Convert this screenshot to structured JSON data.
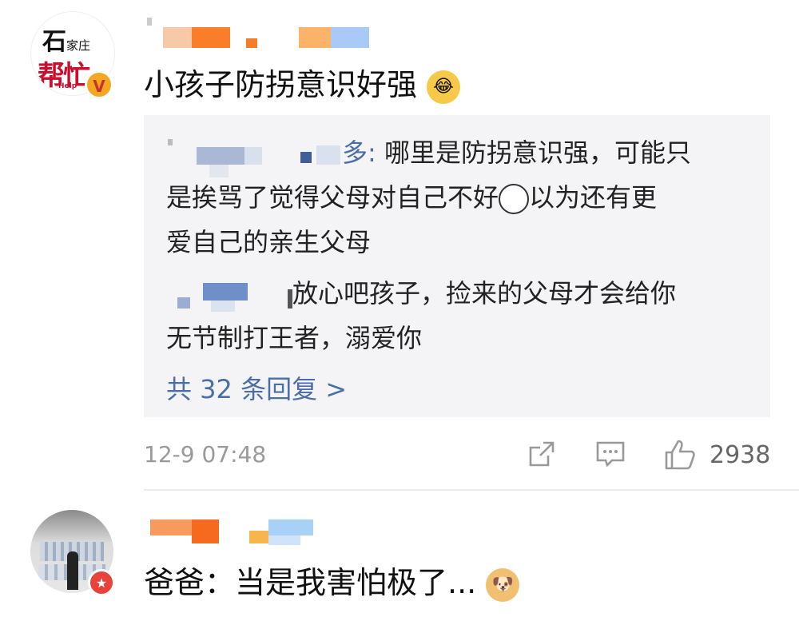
{
  "comment1": {
    "avatar_logo_top": "石",
    "avatar_logo_top_small": "家庄",
    "avatar_logo_bottom": "帮忙",
    "avatar_logo_help": "Help",
    "verify_badge": "V",
    "text": "小孩子防拐意识好强",
    "emoji": "laughing-crying-emoji",
    "replies": [
      {
        "name_suffix": "多:",
        "text_line1": " 哪里是防拐意识强，可能只",
        "text_line2": "是挨骂了觉得父母对自己不好",
        "text_line2_tail": "以为还有更",
        "text_line3": "爱自己的亲生父母"
      },
      {
        "name_suffix": ":",
        "text_line1": "放心吧孩子，捡来的父母才会给你",
        "text_line2": "无节制打王者，溺爱你"
      }
    ],
    "more_replies": "共 32 条回复 >",
    "timestamp": "12-9 07:48",
    "like_count": "2938"
  },
  "comment2": {
    "text": "爸爸：当是我害怕极了...",
    "badge_icon": "star-badge-icon"
  },
  "colors": {
    "link": "#4a6ea6",
    "reply_bg": "#f4f4f6",
    "meta": "#9a9a9a"
  }
}
